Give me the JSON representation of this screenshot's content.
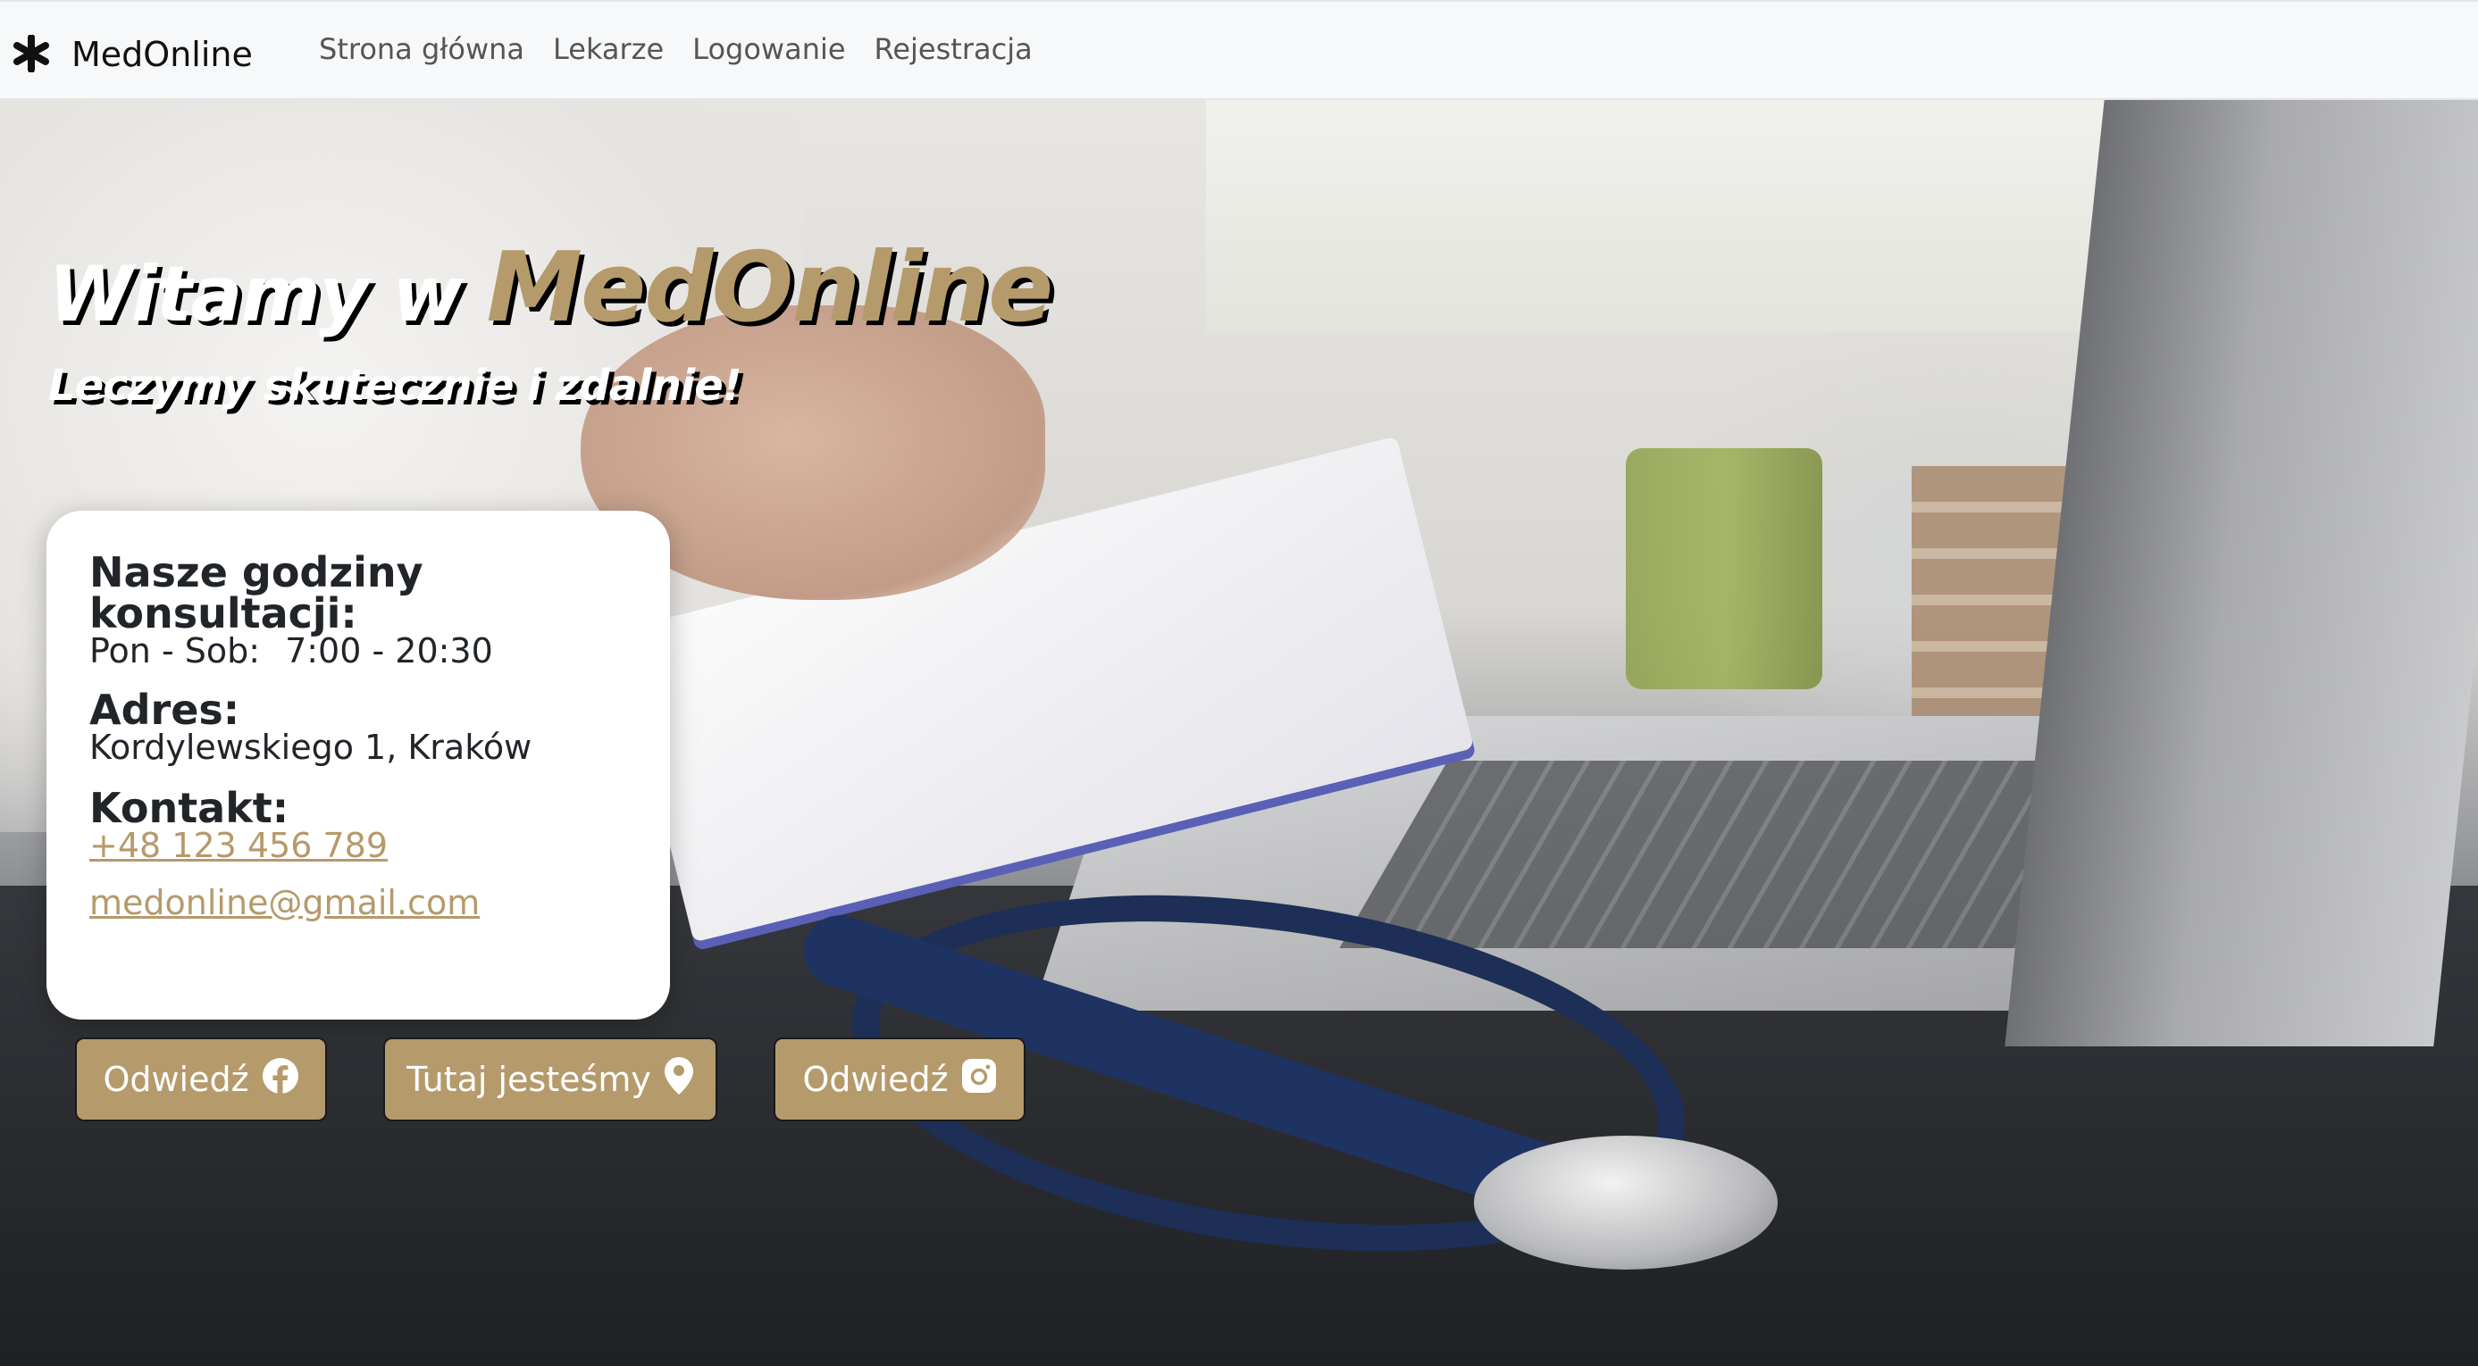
{
  "navbar": {
    "brand_icon": "asterisk-icon",
    "brand": "MedOnline",
    "links": [
      "Strona główna",
      "Lekarze",
      "Logowanie",
      "Rejestracja"
    ]
  },
  "hero": {
    "title_prefix": "Witamy w",
    "title_brand": "MedOnline",
    "subtitle": "Leczymy skutecznie i zdalnie!"
  },
  "info": {
    "hours_heading": "Nasze godziny konsultacji:",
    "hours_days": "Pon - Sob:",
    "hours_time": "7:00 - 20:30",
    "address_heading": "Adres:",
    "address": "Kordylewskiego 1, Kraków",
    "contact_heading": "Kontakt:",
    "phone": "+48 123 456 789",
    "email": "medonline@gmail.com"
  },
  "buttons": {
    "facebook": {
      "label": "Odwiedź",
      "icon": "facebook-icon"
    },
    "map": {
      "label": "Tutaj jesteśmy",
      "icon": "map-pin-icon"
    },
    "instagram": {
      "label": "Odwiedź",
      "icon": "instagram-icon"
    }
  },
  "colors": {
    "accent": "#b59a6b",
    "navbar_bg": "#f7f8f9",
    "text_dark": "#212529"
  }
}
